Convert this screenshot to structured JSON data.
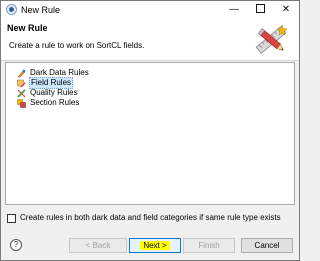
{
  "window": {
    "title": "New Rule",
    "minimize_glyph": "—",
    "close_glyph": "✕"
  },
  "banner": {
    "title": "New Rule",
    "description": "Create a rule to work on SortCL fields.",
    "icon": "rule-wizard-icon"
  },
  "tree": {
    "items": [
      {
        "label": "Dark Data Rules",
        "icon": "dark-data-rule-icon",
        "selected": false
      },
      {
        "label": "Field Rules",
        "icon": "field-rule-icon",
        "selected": true
      },
      {
        "label": "Quality Rules",
        "icon": "quality-rule-icon",
        "selected": false
      },
      {
        "label": "Section Rules",
        "icon": "section-rule-icon",
        "selected": false
      }
    ]
  },
  "options": {
    "create_both_label": "Create rules in both dark data and field categories if same rule type exists",
    "create_both_checked": false
  },
  "buttons": {
    "help": "?",
    "back": "< Back",
    "next": "Next >",
    "finish": "Finish",
    "cancel": "Cancel"
  },
  "colors": {
    "selection": "#cde8ff",
    "highlight": "#ffff00",
    "default_button_border": "#0078d7"
  }
}
